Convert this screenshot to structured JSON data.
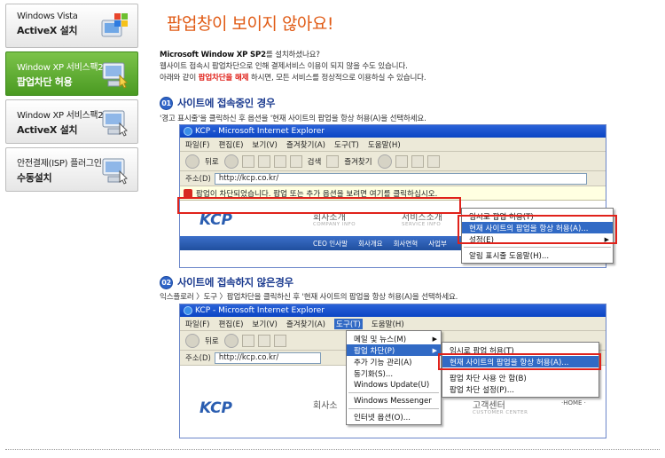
{
  "sidebar": {
    "items": [
      {
        "line1": "Windows Vista",
        "line2": "ActiveX 설치",
        "icon": "windows-flag-icon"
      },
      {
        "line1": "Window XP 서비스팩2",
        "line2": "팝업차단 허용",
        "icon": "computer-icon"
      },
      {
        "line1": "Window XP 서비스팩2",
        "line2": "ActiveX 설치",
        "icon": "computer-icon"
      },
      {
        "line1": "안전결제(ISP) 플러그인",
        "line2": "수동설치",
        "icon": "computer-icon"
      }
    ]
  },
  "main": {
    "title": "팝업창이 보이지 않아요!",
    "intro": {
      "line1_bold": "Microsoft Window XP SP2",
      "line1_rest": "를 설치하셨나요?",
      "line2": "웹사이트 접속시 팝업차단으로 인해 결제서비스 이용이 되지 않을 수도 있습니다.",
      "line3_pre": "아래와 같이 ",
      "line3_red": "팝업차단을 해제",
      "line3_post": " 하시면, 모든 서비스를 정상적으로 이용하실 수 있습니다."
    },
    "section1": {
      "num": "01",
      "title": "사이트에 접속중인 경우",
      "desc": "'경고 표시줄'을 클릭하신 후 옵션을 '현재 사이트의 팝업을 항상 허용(A)을 선택하세요."
    },
    "section2": {
      "num": "02",
      "title": "사이트에 접속하지 않은경우",
      "desc": "익스플로러 〉도구 〉팝업차단을 클릭하신 후 '현재 사이트의 팝업을 항상 허용(A)을 선택하세요."
    }
  },
  "ie1": {
    "title": "KCP - Microsoft Internet Explorer",
    "menu": [
      "파일(F)",
      "편집(E)",
      "보기(V)",
      "즐겨찾기(A)",
      "도구(T)",
      "도움말(H)"
    ],
    "toolbar": {
      "back": "뒤로",
      "search": "검색",
      "favorites": "즐겨찾기"
    },
    "address_label": "주소(D)",
    "url": "http://kcp.co.kr/",
    "infobar": "팝업이 차단되었습니다. 팝업 또는 추가 옵션을 보려면 여기를 클릭하십시오.",
    "logo": "KCP",
    "nav": [
      {
        "label": "회사소개",
        "sub": "COMPANY INFO"
      },
      {
        "label": "서비스소개",
        "sub": "SERVICE INFO"
      }
    ],
    "bar_items": [
      "CEO 인사말",
      "회사개요",
      "회사연혁",
      "사업부"
    ],
    "context_menu": [
      "임시로 팝업 허용(T)",
      "현재 사이트의 팝업을 항상 허용(A)...",
      "설정(E)",
      "알림 표시줄 도움말(H)..."
    ]
  },
  "ie2": {
    "title": "KCP - Microsoft Internet Explorer",
    "menu": [
      "파일(F)",
      "편집(E)",
      "보기(V)",
      "즐겨찾기(A)",
      "도구(T)",
      "도움말(H)"
    ],
    "toolbar": {
      "back": "뒤로"
    },
    "address_label": "주소(D)",
    "url": "http://kcp.co.kr/",
    "logo": "KCP",
    "nav": [
      {
        "label": "회사소",
        "sub": ""
      },
      {
        "label": "고객센터",
        "sub": "CUSTOMER CENTER"
      }
    ],
    "home": "·HOME ·",
    "tools_menu": [
      "메일 및 뉴스(M)",
      "팝업 차단(P)",
      "추가 기능 관리(A)",
      "동기화(S)...",
      "Windows Update(U)",
      "Windows Messenger",
      "인터넷 옵션(O)..."
    ],
    "popup_submenu": [
      "임시로 팝업 허용(T)",
      "현재 사이트의 팝업을 항상 허용(A)...",
      "팝업 차단 사용 안 함(B)",
      "팝업 차단 설정(P)..."
    ]
  }
}
